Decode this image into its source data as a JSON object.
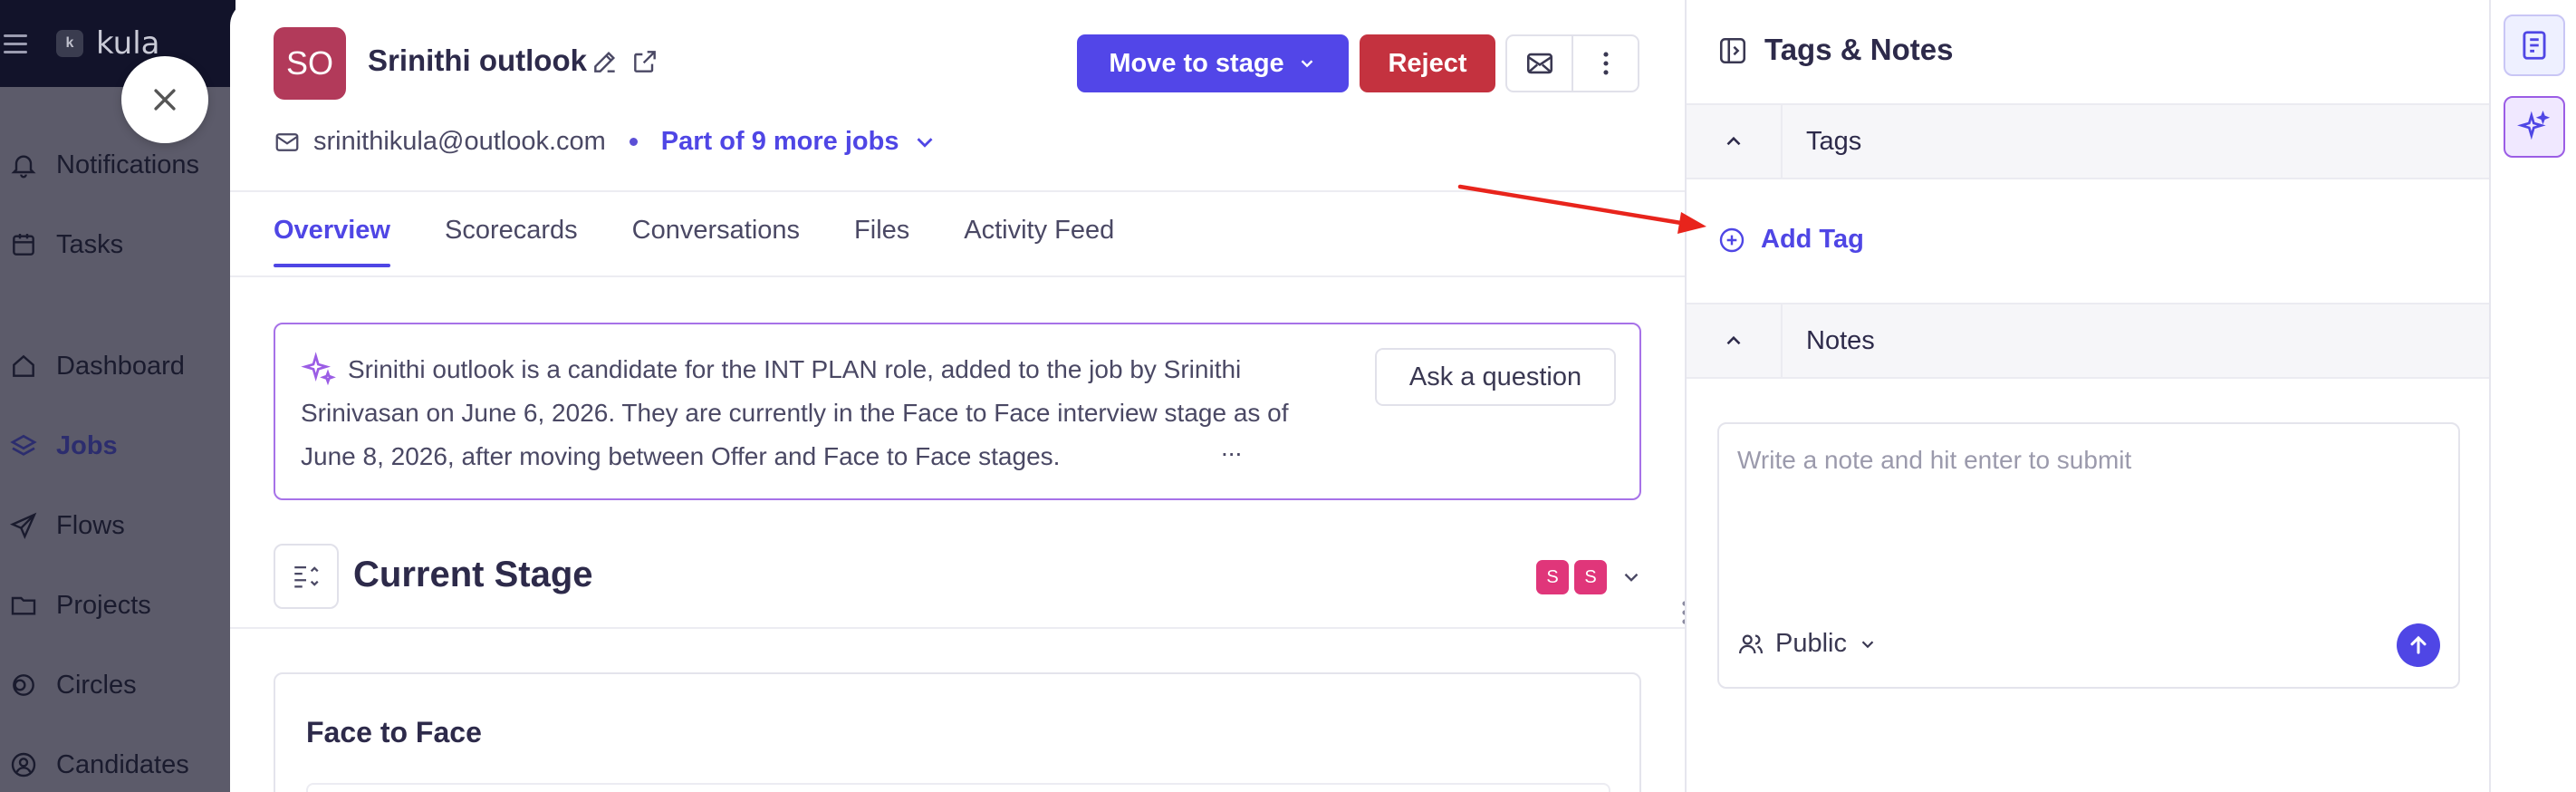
{
  "app": {
    "brand": "kula",
    "nav": [
      {
        "label": "Notifications",
        "icon": "bell-icon"
      },
      {
        "label": "Tasks",
        "icon": "calendar-icon"
      },
      {
        "label": "Dashboard",
        "icon": "home-icon"
      },
      {
        "label": "Jobs",
        "icon": "layers-icon"
      },
      {
        "label": "Flows",
        "icon": "send-icon"
      },
      {
        "label": "Projects",
        "icon": "folder-icon"
      },
      {
        "label": "Circles",
        "icon": "circles-icon"
      },
      {
        "label": "Candidates",
        "icon": "user-circle-icon"
      }
    ]
  },
  "candidate": {
    "initials": "SO",
    "name": "Srinithi outlook",
    "email": "srinithikula@outlook.com",
    "more_jobs": "Part of 9 more jobs"
  },
  "actions": {
    "move_to_stage": "Move to stage",
    "reject": "Reject"
  },
  "tabs": [
    "Overview",
    "Scorecards",
    "Conversations",
    "Files",
    "Activity Feed"
  ],
  "ai_summary": {
    "text": "Srinithi outlook is a candidate for the INT PLAN role, added to the job by Srinithi Srinivasan on June 6, 2026. They are currently in the Face to Face interview stage as of June 8, 2026, after moving between Offer and Face to Face stages.",
    "ellipsis": "...",
    "ask_button": "Ask a question"
  },
  "current_stage": {
    "title": "Current Stage",
    "avatars": [
      "S",
      "S"
    ],
    "stage_name": "Face to Face"
  },
  "right_panel": {
    "title": "Tags & Notes",
    "tags_section": "Tags",
    "add_tag": "Add Tag",
    "notes_section": "Notes",
    "note_placeholder": "Write a note and hit enter to submit",
    "visibility": "Public"
  },
  "colors": {
    "primary": "#5246e8",
    "reject": "#c4323f",
    "avatar": "#b23a5a",
    "ai_border": "#a772e8",
    "annotation_arrow": "#e8241c"
  }
}
